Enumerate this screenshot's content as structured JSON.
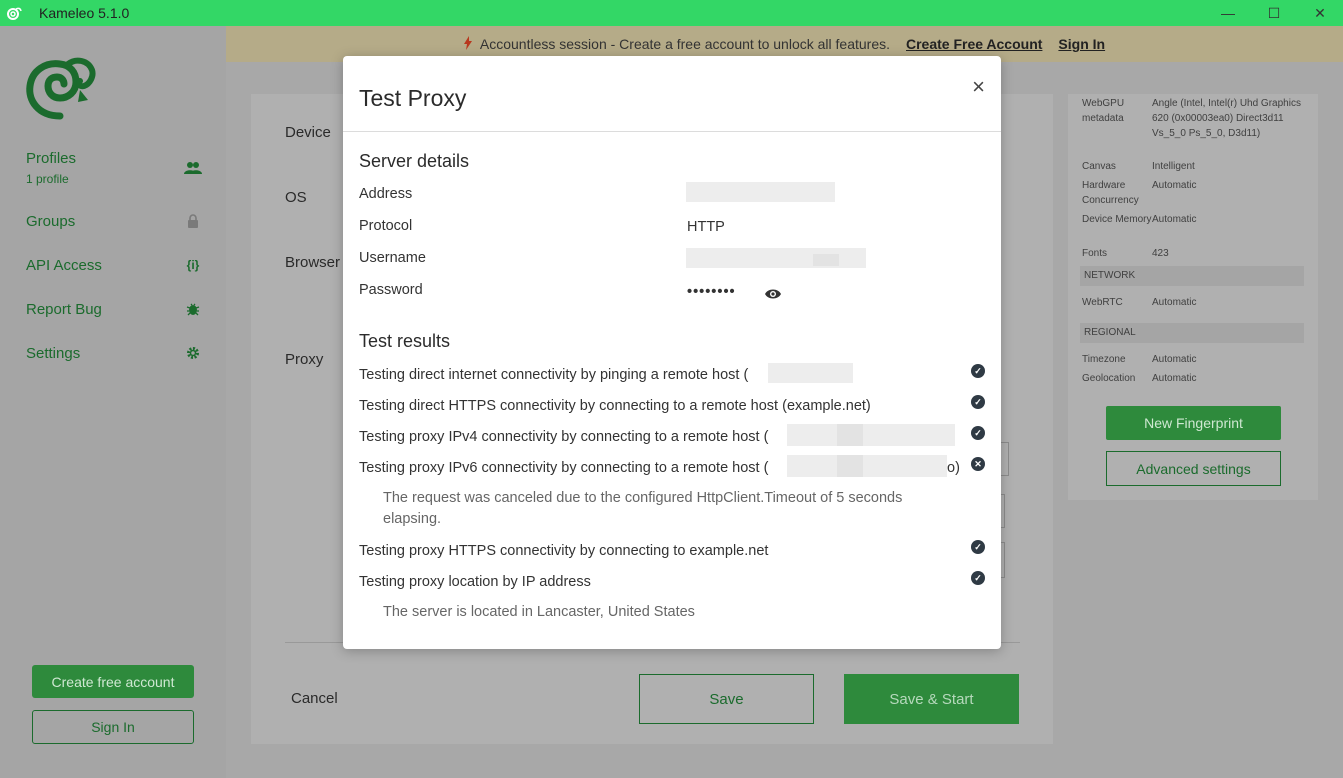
{
  "window": {
    "title": "Kameleo 5.1.0",
    "controls": {
      "minimize": "—",
      "maximize": "☐",
      "close": "✕"
    }
  },
  "sidebar": {
    "items": [
      {
        "label": "Profiles",
        "sub": "1 profile",
        "icon": "users-icon"
      },
      {
        "label": "Groups",
        "icon": "lock-icon"
      },
      {
        "label": "API Access",
        "icon": "api-icon"
      },
      {
        "label": "Report Bug",
        "icon": "bug-icon"
      },
      {
        "label": "Settings",
        "icon": "gear-icon"
      }
    ],
    "create_account": "Create free account",
    "sign_in": "Sign In"
  },
  "banner": {
    "text": "Accountless session - Create a free account to unlock all features.",
    "create_link": "Create Free Account",
    "signin_link": "Sign In"
  },
  "form": {
    "device_label": "Device",
    "os_label": "OS",
    "browser_label": "Browser",
    "proxy_label": "Proxy",
    "cancel": "Cancel",
    "save": "Save",
    "save_start": "Save & Start"
  },
  "fingerprint": {
    "rows": [
      {
        "key": "WebGPU metadata",
        "value": "Angle (Intel, Intel(r) Uhd Graphics 620 (0x00003ea0) Direct3d11 Vs_5_0 Ps_5_0, D3d11)"
      },
      {
        "key": "Canvas",
        "value": "Intelligent"
      },
      {
        "key": "Hardware Concurrency",
        "value": "Automatic"
      },
      {
        "key": "Device Memory",
        "value": "Automatic"
      },
      {
        "key": "Fonts",
        "value": "423"
      },
      {
        "key": "WebRTC",
        "value": "Automatic"
      },
      {
        "key": "Timezone",
        "value": "Automatic"
      },
      {
        "key": "Geolocation",
        "value": "Automatic"
      }
    ],
    "network_section": "NETWORK",
    "regional_section": "REGIONAL",
    "new_fingerprint": "New Fingerprint",
    "advanced_settings": "Advanced settings"
  },
  "modal": {
    "title": "Test Proxy",
    "close": "×",
    "server_details_title": "Server details",
    "address_label": "Address",
    "protocol_label": "Protocol",
    "protocol_value": "HTTP",
    "username_label": "Username",
    "password_label": "Password",
    "password_value": "••••••••",
    "test_results_title": "Test results",
    "tests": [
      {
        "text": "Testing direct internet connectivity by pinging a remote host (",
        "status": "success"
      },
      {
        "text": "Testing direct HTTPS connectivity by connecting to a remote host (example.net)",
        "status": "success"
      },
      {
        "text": "Testing proxy IPv4 connectivity by connecting to a remote host (",
        "status": "success"
      },
      {
        "text": "Testing proxy IPv6 connectivity by connecting to a remote host (",
        "suffix": "o)",
        "status": "failure"
      },
      {
        "text": "Testing proxy HTTPS connectivity by connecting to example.net",
        "status": "success"
      },
      {
        "text": "Testing proxy location by IP address",
        "status": "success"
      }
    ],
    "ipv6_note": "The request was canceled due to the configured HttpClient.Timeout of 5 seconds elapsing.",
    "location_note": "The server is located in Lancaster, United States"
  },
  "colors": {
    "accent": "#2e8a3c",
    "titlebar": "#33d766",
    "status_icon": "#2f3a44"
  }
}
